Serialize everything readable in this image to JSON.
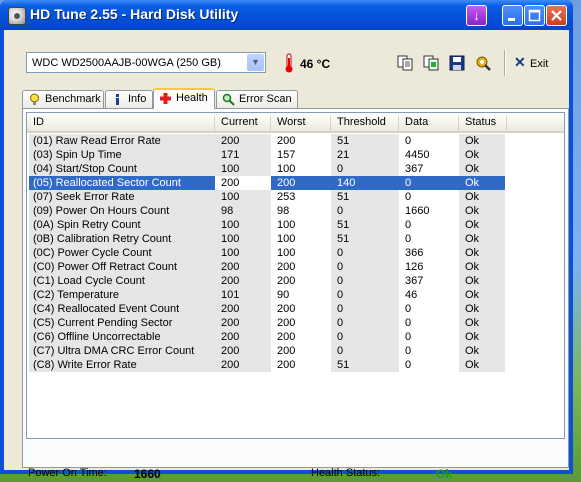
{
  "window": {
    "title": "HD Tune 2.55 - Hard Disk Utility",
    "controls": {
      "special": "↓",
      "minimize": "_",
      "maximize": "□",
      "close": "✕"
    }
  },
  "toolbar": {
    "drive": "WDC WD2500AAJB-00WGA (250 GB)",
    "temperature": "46 °C",
    "exit_label": "Exit",
    "icons": [
      "copy-icon",
      "copy-screen-icon",
      "save-icon",
      "options-icon"
    ]
  },
  "tabs": [
    {
      "label": "Benchmark",
      "icon": "lightbulb-icon"
    },
    {
      "label": "Info",
      "icon": "info-icon"
    },
    {
      "label": "Health",
      "icon": "health-cross-icon"
    },
    {
      "label": "Error Scan",
      "icon": "magnifier-icon"
    }
  ],
  "active_tab": "Health",
  "table": {
    "columns": [
      "ID",
      "Current",
      "Worst",
      "Threshold",
      "Data",
      "Status"
    ],
    "rows": [
      [
        "(01) Raw Read Error Rate",
        "200",
        "200",
        "51",
        "0",
        "Ok"
      ],
      [
        "(03) Spin Up Time",
        "171",
        "157",
        "21",
        "4450",
        "Ok"
      ],
      [
        "(04) Start/Stop Count",
        "100",
        "100",
        "0",
        "367",
        "Ok"
      ],
      [
        "(05) Reallocated Sector Count",
        "200",
        "200",
        "140",
        "0",
        "Ok"
      ],
      [
        "(07) Seek Error Rate",
        "100",
        "253",
        "51",
        "0",
        "Ok"
      ],
      [
        "(09) Power On Hours Count",
        "98",
        "98",
        "0",
        "1660",
        "Ok"
      ],
      [
        "(0A) Spin Retry Count",
        "100",
        "100",
        "51",
        "0",
        "Ok"
      ],
      [
        "(0B) Calibration Retry Count",
        "100",
        "100",
        "51",
        "0",
        "Ok"
      ],
      [
        "(0C) Power Cycle Count",
        "100",
        "100",
        "0",
        "366",
        "Ok"
      ],
      [
        "(C0) Power Off Retract Count",
        "200",
        "200",
        "0",
        "126",
        "Ok"
      ],
      [
        "(C1) Load Cycle Count",
        "200",
        "200",
        "0",
        "367",
        "Ok"
      ],
      [
        "(C2) Temperature",
        "101",
        "90",
        "0",
        "46",
        "Ok"
      ],
      [
        "(C4) Reallocated Event Count",
        "200",
        "200",
        "0",
        "0",
        "Ok"
      ],
      [
        "(C5) Current Pending Sector",
        "200",
        "200",
        "0",
        "0",
        "Ok"
      ],
      [
        "(C6) Offline Uncorrectable",
        "200",
        "200",
        "0",
        "0",
        "Ok"
      ],
      [
        "(C7) Ultra DMA CRC Error Count",
        "200",
        "200",
        "0",
        "0",
        "Ok"
      ],
      [
        "(C8) Write Error Rate",
        "200",
        "200",
        "51",
        "0",
        "Ok"
      ]
    ],
    "selected_row": 3
  },
  "footer": {
    "power_on_label": "Power On Time:",
    "power_on_value": "1660",
    "health_label": "Health Status:",
    "health_value": "Ok"
  },
  "colors": {
    "titlebar": "#0450d6",
    "selection": "#316ac5",
    "health_ok": "#1a9a1a",
    "window_bg": "#ece9d8"
  }
}
